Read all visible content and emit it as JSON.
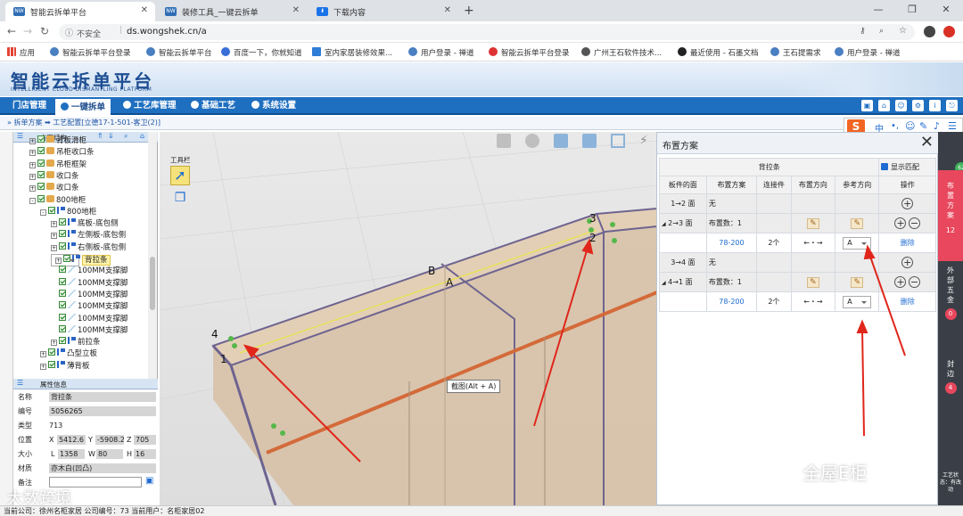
{
  "browser": {
    "tabs": [
      {
        "title": "智能云拆单平台",
        "active": true
      },
      {
        "title": "装修工具_一键云拆单",
        "active": false
      },
      {
        "title": "下载内容",
        "active": false
      }
    ],
    "security_label": "不安全",
    "url": "ds.wongshek.cn/a",
    "bookmarks": [
      "应用",
      "智能云拆单平台登录",
      "智能云拆单平台",
      "百度一下，你就知道",
      "室内家居装修效果...",
      "用户登录 - 禅道",
      "智能云拆单平台登录",
      "广州王石软件技术...",
      "最近使用 - 石墨文档",
      "王石提需求",
      "用户登录 - 禅道"
    ]
  },
  "app": {
    "title": "智能云拆单平台",
    "subtitle": "INTELLIGENT CLOUD DISMANTLING PLATFORM",
    "nav": [
      {
        "label": "门店管理",
        "active": false
      },
      {
        "label": "一键拆单",
        "active": true
      },
      {
        "label": "工艺库管理",
        "active": false
      },
      {
        "label": "基础工艺",
        "active": false
      },
      {
        "label": "系统设置",
        "active": false
      }
    ],
    "breadcrumb": "拆单方案 ➡ 工艺配置[立德17-1-501-客卫(2)]"
  },
  "tree": {
    "header": "方案结构",
    "nodes": [
      {
        "label": "背板滑柜",
        "indent": 0,
        "icon": "box",
        "pm": "+"
      },
      {
        "label": "吊柜收口条",
        "indent": 0,
        "icon": "box",
        "pm": "+"
      },
      {
        "label": "吊柜框架",
        "indent": 0,
        "icon": "box",
        "pm": "+"
      },
      {
        "label": "收口条",
        "indent": 0,
        "icon": "box",
        "pm": "+"
      },
      {
        "label": "收口条",
        "indent": 0,
        "icon": "box",
        "pm": "+"
      },
      {
        "label": "800地柜",
        "indent": 0,
        "icon": "box",
        "pm": "-"
      },
      {
        "label": "800地柜",
        "indent": 1,
        "icon": "flag",
        "pm": "-"
      },
      {
        "label": "底板-底包侧",
        "indent": 2,
        "icon": "flag",
        "pm": "+"
      },
      {
        "label": "左侧板-底包侧",
        "indent": 2,
        "icon": "flag",
        "pm": "+"
      },
      {
        "label": "右侧板-底包侧",
        "indent": 2,
        "icon": "flag",
        "pm": "+"
      },
      {
        "label": "背拉条",
        "indent": 2,
        "icon": "flag",
        "pm": "+",
        "selected": true
      },
      {
        "label": "100MM支撑脚",
        "indent": 2,
        "icon": "leg",
        "pm": ""
      },
      {
        "label": "100MM支撑脚",
        "indent": 2,
        "icon": "leg",
        "pm": ""
      },
      {
        "label": "100MM支撑脚",
        "indent": 2,
        "icon": "leg",
        "pm": ""
      },
      {
        "label": "100MM支撑脚",
        "indent": 2,
        "icon": "leg",
        "pm": ""
      },
      {
        "label": "100MM支撑脚",
        "indent": 2,
        "icon": "leg",
        "pm": ""
      },
      {
        "label": "100MM支撑脚",
        "indent": 2,
        "icon": "leg",
        "pm": ""
      },
      {
        "label": "前拉条",
        "indent": 2,
        "icon": "flag",
        "pm": "+"
      },
      {
        "label": "凸型立板",
        "indent": 1,
        "icon": "flag",
        "pm": "+"
      },
      {
        "label": "薄背板",
        "indent": 1,
        "icon": "flag",
        "pm": "+"
      }
    ]
  },
  "props": {
    "header": "属性信息",
    "name_label": "名称",
    "name": "背拉条",
    "code_label": "编号",
    "code": "5056265",
    "type_label": "类型",
    "type": "713",
    "pos_label": "位置",
    "pos_x": "5412.6",
    "pos_y": "-5908.2",
    "pos_z": "705",
    "size_label": "大小",
    "size_l": "1358",
    "size_w": "80",
    "size_h": "16",
    "material_label": "材质",
    "material": "亦木白(凹凸)",
    "note_label": "备注",
    "axis_x": "X",
    "axis_y": "Y",
    "axis_z": "Z",
    "axis_l": "L",
    "axis_w": "W",
    "axis_h": "H"
  },
  "viewport": {
    "toolbar_label": "工具栏",
    "tooltip": "截图(Alt + A)",
    "face_labels": [
      "3",
      "2",
      "B",
      "A",
      "4",
      "1"
    ]
  },
  "dialog": {
    "title": "布置方案",
    "part_name": "背拉条",
    "show_match_label": "显示匹配",
    "columns": [
      "板件的面",
      "布置方案",
      "连接件",
      "布置方向",
      "参考方向",
      "操作"
    ],
    "rows": [
      {
        "face": "1→2 面",
        "plan": "无"
      },
      {
        "face": "2→3 面",
        "plan": "布置数：1",
        "detail": {
          "plan": "78-200",
          "connector": "2个",
          "direction": "←・→",
          "ref": "A",
          "op": "删除"
        }
      },
      {
        "face": "3→4 面",
        "plan": "无"
      },
      {
        "face": "4→1 面",
        "plan": "布置数：1",
        "detail": {
          "plan": "78-200",
          "connector": "2个",
          "direction": "←・→",
          "ref": "A",
          "op": "删除"
        }
      }
    ]
  },
  "side": {
    "tab1": "布置方案",
    "tab1_count": "12",
    "tab2": "外部五金",
    "tab2_count": "0",
    "tab3": "封边",
    "tab3_count": "4",
    "footer": "工艺状态：有改动"
  },
  "status": {
    "text": "当前公司：徐州名柜家居  公司编号：73  当前用户：名柜家居02"
  },
  "watermarks": [
    "全屋E柜",
    "大数跨境"
  ],
  "colors": {
    "nav_blue": "#1f6fc0",
    "accent_red": "#e8475d",
    "link": "#1e6bd1"
  }
}
